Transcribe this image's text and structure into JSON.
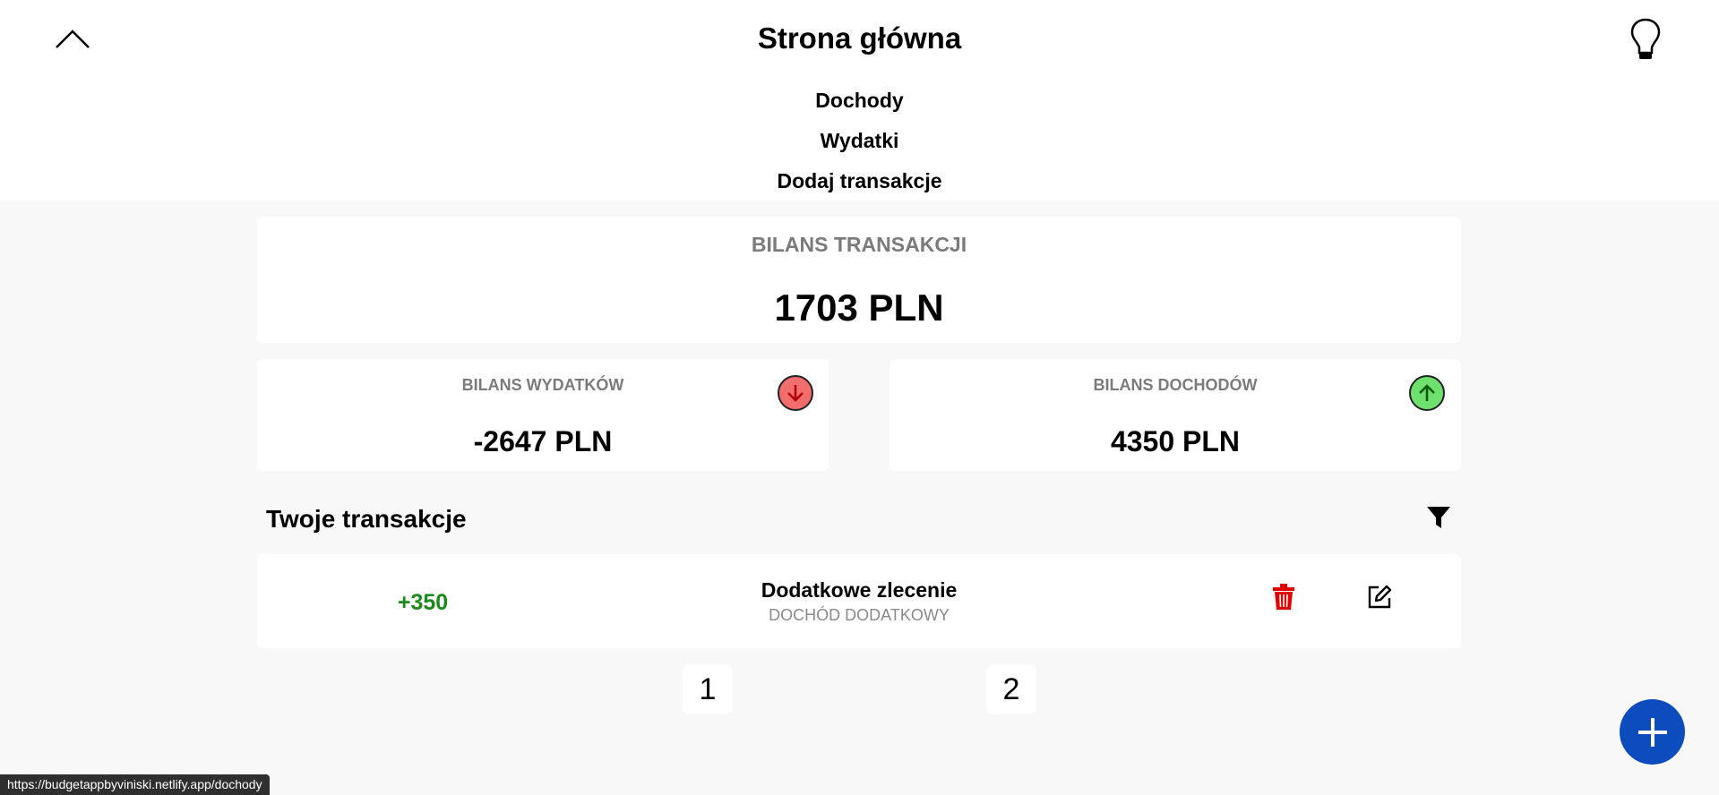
{
  "header": {
    "title": "Strona główna",
    "collapse_icon": "chevron-up-icon",
    "theme_icon": "lightbulb-icon",
    "nav": [
      {
        "label": "Dochody"
      },
      {
        "label": "Wydatki"
      },
      {
        "label": "Dodaj transakcje"
      }
    ]
  },
  "summary": {
    "total_label": "BILANS TRANSAKCJI",
    "total_value": "1703 PLN",
    "expenses": {
      "label": "BILANS WYDATKÓW",
      "value": "-2647 PLN",
      "icon": "arrow-down-circle-icon",
      "color": "#f26d6d"
    },
    "income": {
      "label": "BILANS DOCHODÓW",
      "value": "4350 PLN",
      "icon": "arrow-up-circle-icon",
      "color": "#6de06d"
    }
  },
  "transactions": {
    "title": "Twoje transakcje",
    "filter_icon": "filter-icon",
    "items": [
      {
        "amount": "+350",
        "name": "Dodatkowe zlecenie",
        "category": "DOCHÓD DODATKOWY",
        "amount_color": "#1a8a1a"
      }
    ]
  },
  "pagination": {
    "pages": [
      "1",
      "2"
    ]
  },
  "fab": {
    "icon": "plus-icon",
    "color": "#0c4cbc"
  },
  "status_url": "https://budgetappbyviniski.netlify.app/dochody"
}
